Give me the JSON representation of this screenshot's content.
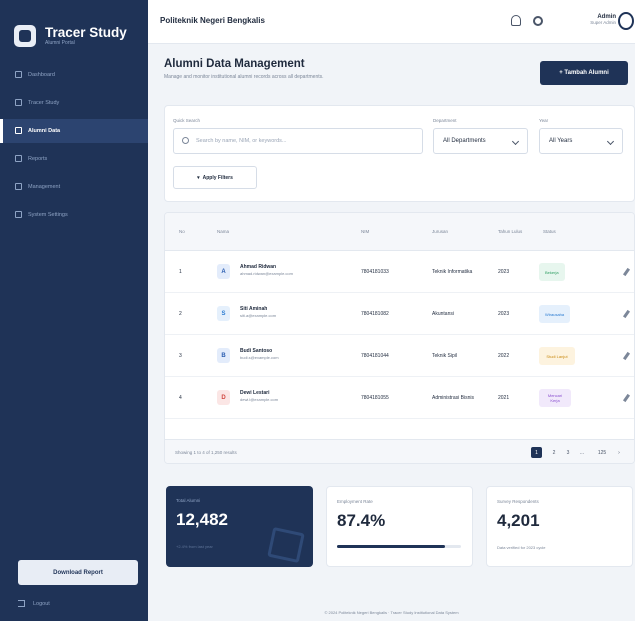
{
  "sidebar": {
    "app_title": "Tracer Study",
    "app_subtitle": "Alumni Portal",
    "nav": [
      {
        "label": "Dashboard",
        "icon": "grid-icon"
      },
      {
        "label": "Tracer Study",
        "icon": "chart-icon"
      },
      {
        "label": "Alumni Data",
        "icon": "users-icon",
        "active": true
      },
      {
        "label": "Reports",
        "icon": "file-icon"
      },
      {
        "label": "Management",
        "icon": "briefcase-icon"
      },
      {
        "label": "System Settings",
        "icon": "gear-icon"
      }
    ],
    "download_label": "Download Report",
    "logout_label": "Logout"
  },
  "header": {
    "title": "Politeknik Negeri Bengkalis",
    "user_name": "Admin",
    "user_role": "Super Admin"
  },
  "page": {
    "title": "Alumni Data Management",
    "subtitle": "Manage and monitor institutional alumni records across all departments.",
    "add_button": "+ Tambah Alumni"
  },
  "filters": {
    "search_label": "Quick Search",
    "search_placeholder": "Search by name, NIM, or keywords...",
    "department_label": "Department",
    "department_value": "All Departments",
    "year_label": "Year",
    "year_value": "All Years",
    "apply_label": "Apply Filters"
  },
  "table": {
    "headers": [
      "No",
      "Nama",
      "NIM",
      "Jurusan",
      "Tahun Lulus",
      "Status"
    ],
    "rows": [
      {
        "no": "1",
        "initial": "A",
        "name": "Ahmad Ridwan",
        "email": "ahmad.ridwan@example.com",
        "nim": "7804181033",
        "jurusan": "Teknik Informatika",
        "tahun": "2023",
        "status": "Bekerja",
        "status_color": "#2f9e63",
        "status_bg": "#e7f6ee",
        "initial_color": "#2a5db0",
        "initial_bg": "#e3ecfb"
      },
      {
        "no": "2",
        "initial": "S",
        "name": "Siti Aminah",
        "email": "siti.a@example.com",
        "nim": "7804181082",
        "jurusan": "Akuntansi",
        "tahun": "2023",
        "status": "Wirausaha",
        "status_color": "#2a7bd1",
        "status_bg": "#e5f0fc",
        "initial_color": "#2a7bd1",
        "initial_bg": "#e5f0fc"
      },
      {
        "no": "3",
        "initial": "B",
        "name": "Budi Santoso",
        "email": "budi.s@example.com",
        "nim": "7804181044",
        "jurusan": "Teknik Sipil",
        "tahun": "2022",
        "status": "Studi Lanjut",
        "status_color": "#c98a12",
        "status_bg": "#fdf3df",
        "initial_color": "#2a5db0",
        "initial_bg": "#e3ecfb"
      },
      {
        "no": "4",
        "initial": "D",
        "name": "Dewi Lestari",
        "email": "dewi.l@example.com",
        "nim": "7804181055",
        "jurusan": "Administrasi Bisnis",
        "tahun": "2021",
        "status": "Mencari Kerja",
        "status_color": "#8a4fd0",
        "status_bg": "#f1e9fb",
        "initial_color": "#d0463f",
        "initial_bg": "#fbe6e5"
      }
    ],
    "showing": "Showing 1 to 4 of 1,250 results",
    "pages": [
      "1",
      "2",
      "3",
      "...",
      "125"
    ]
  },
  "stats": [
    {
      "label": "Total Alumni",
      "value": "12,482",
      "note": "+2.4% from last year"
    },
    {
      "label": "Employment Rate",
      "value": "87.4%",
      "progress": 0.874
    },
    {
      "label": "Survey Respondents",
      "value": "4,201",
      "note": "Data verified for 2023 cycle"
    }
  ],
  "footer": "© 2024 Politeknik Negeri Bengkalis · Tracer Study Institutional Data System"
}
